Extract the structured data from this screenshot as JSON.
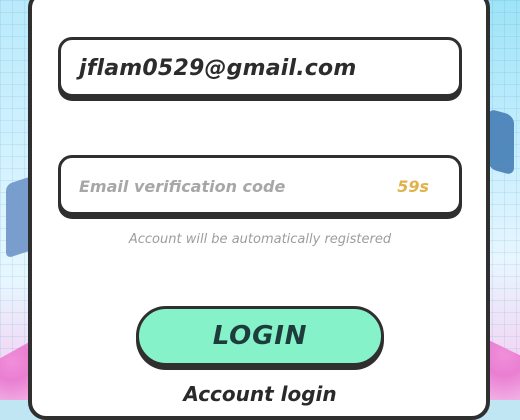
{
  "form": {
    "email_value": "jflam0529@gmail.com",
    "code_placeholder": "Email verification code",
    "countdown": "59s",
    "hint": "Account will be automatically registered",
    "login_label": "LOGIN",
    "account_login_link": "Account login"
  },
  "colors": {
    "login_button": "#86f2c9",
    "countdown": "#e2b24a",
    "panel_border": "#2f2f2f"
  }
}
